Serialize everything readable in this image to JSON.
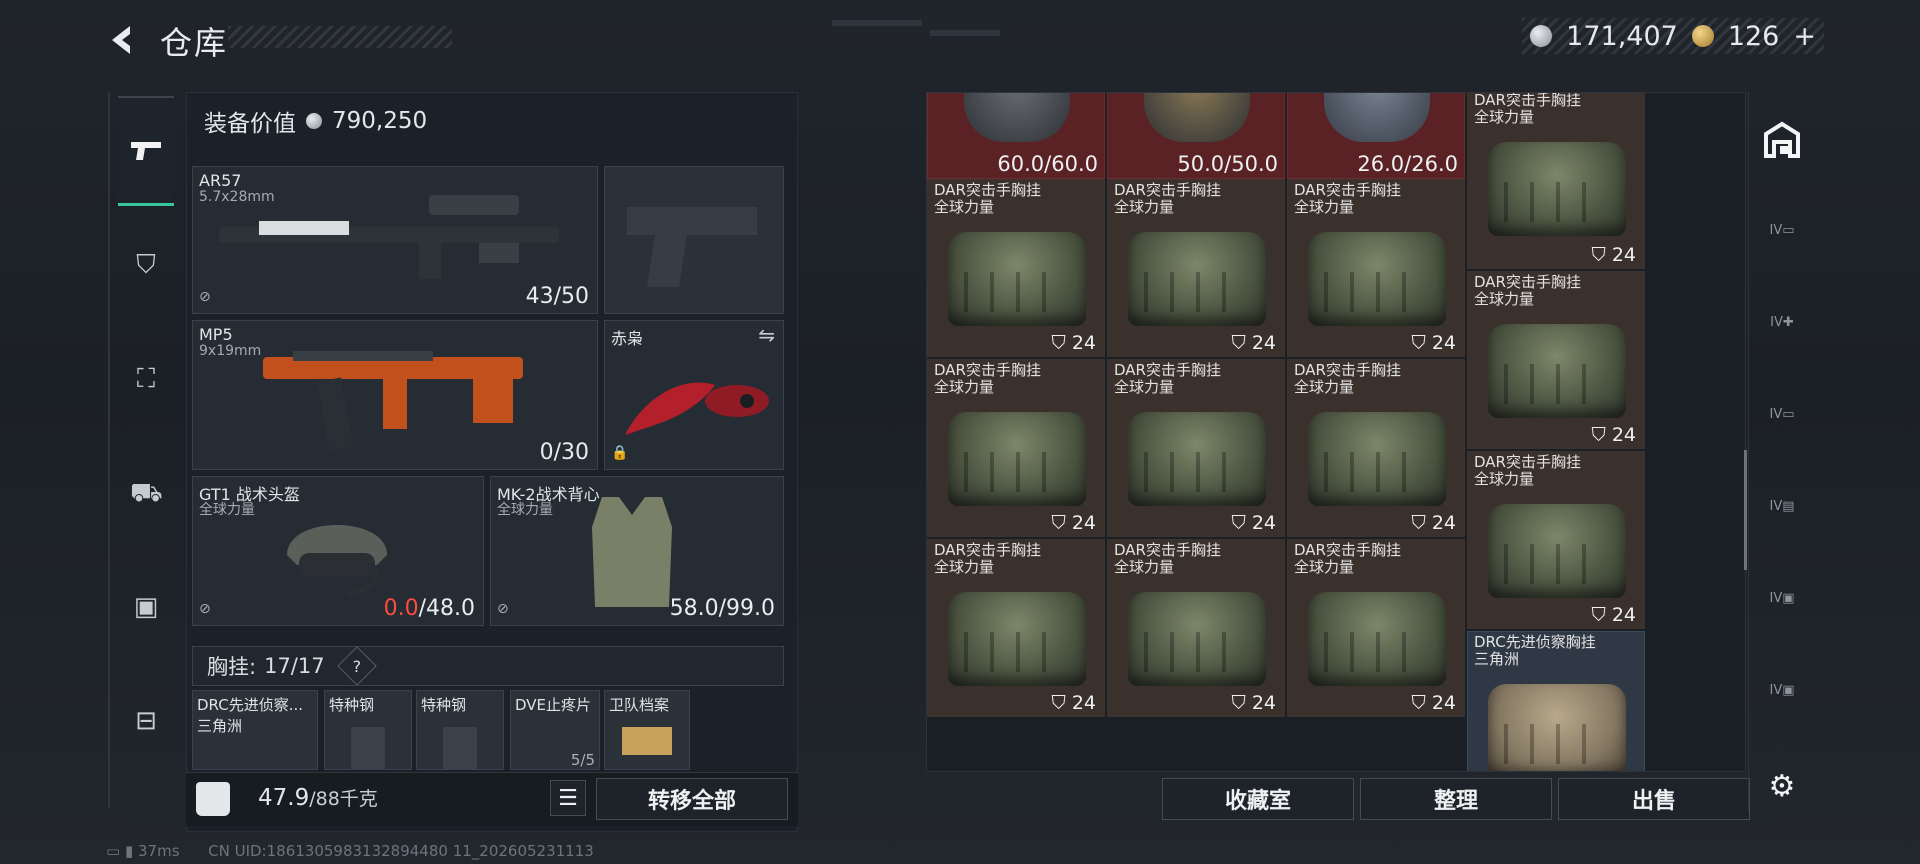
{
  "header": {
    "title": "仓库",
    "currency_silver": "171,407",
    "currency_gold": "126",
    "add_label": "+"
  },
  "loadout": {
    "equip_value_label": "装备价值",
    "equip_value": "790,250",
    "primary": {
      "name": "AR57",
      "caliber": "5.7x28mm",
      "ammo": "43/50"
    },
    "secondary": {
      "name": "MP5",
      "caliber": "9x19mm",
      "ammo": "0/30"
    },
    "melee": {
      "name": "赤枭"
    },
    "helmet": {
      "name": "GT1 战术头盔",
      "brand": "全球力量",
      "durability_current": "0.0",
      "durability_max": "/48.0"
    },
    "vest": {
      "name": "MK-2战术背心",
      "brand": "全球力量",
      "durability": "58.0/99.0"
    },
    "chest_rig": {
      "label": "胸挂:",
      "count": "17/17",
      "help": "?"
    },
    "mini_items": [
      {
        "name": "DRC先进侦察...",
        "sub": "三角洲"
      },
      {
        "name": "特种钢",
        "sub": ""
      },
      {
        "name": "特种钢",
        "sub": ""
      },
      {
        "name": "DVE止疼片",
        "sub": "5/5"
      },
      {
        "name": "卫队档案",
        "sub": ""
      }
    ],
    "weight_current": "47.9",
    "weight_max": "/88千克",
    "transfer_all": "转移全部"
  },
  "stash": {
    "top_row": [
      {
        "dur": "60.0/60.0"
      },
      {
        "dur": "50.0/50.0"
      },
      {
        "dur": "26.0/26.0"
      }
    ],
    "item_name": "DAR突击手胸挂",
    "item_brand": "全球力量",
    "item_count": "24",
    "last_item": {
      "name": "DRC先进侦察胸挂",
      "brand": "三角洲"
    }
  },
  "actions": {
    "collection": "收藏室",
    "sort": "整理",
    "sell": "出售"
  },
  "right_tabs": [
    "IV",
    "IV",
    "IV",
    "IV",
    "IV",
    "IV"
  ],
  "status": {
    "ping": "37ms",
    "uid": "CN UID:1861305983132894480 11_202605231113"
  }
}
